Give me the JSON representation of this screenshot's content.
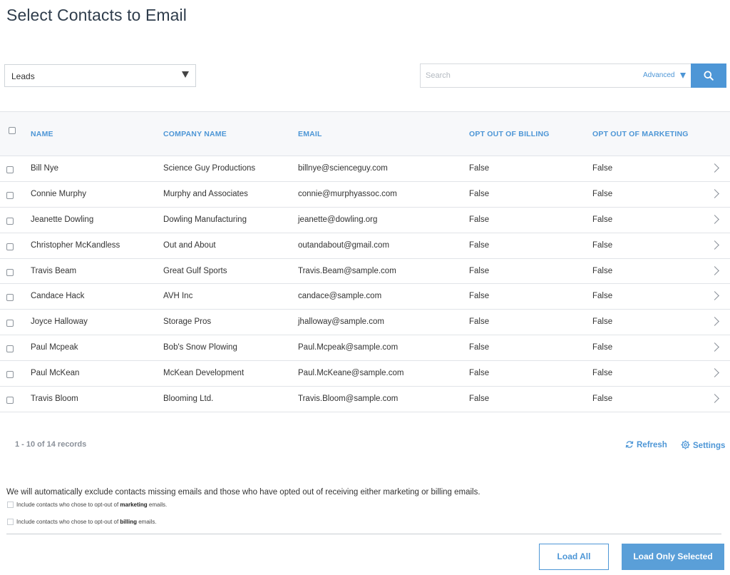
{
  "page": {
    "title": "Select Contacts to Email"
  },
  "filter": {
    "selected": "Leads"
  },
  "search": {
    "placeholder": "Search",
    "value": "",
    "advanced_label": "Advanced"
  },
  "table": {
    "headers": {
      "name": "NAME",
      "company": "COMPANY NAME",
      "email": "EMAIL",
      "billing": "OPT OUT OF BILLING",
      "marketing": "OPT OUT OF MARKETING"
    },
    "rows": [
      {
        "name": "Bill Nye",
        "company": "Science Guy Productions",
        "email": "billnye@scienceguy.com",
        "billing": "False",
        "marketing": "False"
      },
      {
        "name": "Connie Murphy",
        "company": "Murphy and Associates",
        "email": "connie@murphyassoc.com",
        "billing": "False",
        "marketing": "False"
      },
      {
        "name": "Jeanette Dowling",
        "company": "Dowling Manufacturing",
        "email": "jeanette@dowling.org",
        "billing": "False",
        "marketing": "False"
      },
      {
        "name": "Christopher McKandless",
        "company": "Out and About",
        "email": "outandabout@gmail.com",
        "billing": "False",
        "marketing": "False"
      },
      {
        "name": "Travis Beam",
        "company": "Great Gulf Sports",
        "email": "Travis.Beam@sample.com",
        "billing": "False",
        "marketing": "False"
      },
      {
        "name": "Candace Hack",
        "company": "AVH Inc",
        "email": "candace@sample.com",
        "billing": "False",
        "marketing": "False"
      },
      {
        "name": "Joyce Halloway",
        "company": "Storage Pros",
        "email": "jhalloway@sample.com",
        "billing": "False",
        "marketing": "False"
      },
      {
        "name": "Paul Mcpeak",
        "company": "Bob's Snow Plowing",
        "email": "Paul.Mcpeak@sample.com",
        "billing": "False",
        "marketing": "False"
      },
      {
        "name": "Paul McKean",
        "company": "McKean Development",
        "email": "Paul.McKeane@sample.com",
        "billing": "False",
        "marketing": "False"
      },
      {
        "name": "Travis Bloom",
        "company": "Blooming Ltd.",
        "email": "Travis.Bloom@sample.com",
        "billing": "False",
        "marketing": "False"
      }
    ]
  },
  "footer": {
    "records": "1 - 10 of 14 records",
    "refresh_label": "Refresh",
    "settings_label": "Settings"
  },
  "notice": {
    "text": "We will automatically exclude contacts missing emails and those who have opted out of receiving either marketing or billing emails.",
    "opt_marketing": {
      "prefix": "Include contacts who chose to opt-out of ",
      "strong": "marketing",
      "suffix": " emails."
    },
    "opt_billing": {
      "prefix": "Include contacts who chose to opt-out of ",
      "strong": "billing",
      "suffix": " emails."
    }
  },
  "actions": {
    "load_all": "Load All",
    "load_selected": "Load Only Selected"
  },
  "colors": {
    "accent": "#4d96d6",
    "title": "#2f3d4c"
  },
  "icons": {
    "search": "search-icon",
    "refresh": "refresh-icon",
    "settings": "gear-icon",
    "row_open": "chevron-right-icon",
    "dropdown": "caret-down-icon"
  }
}
